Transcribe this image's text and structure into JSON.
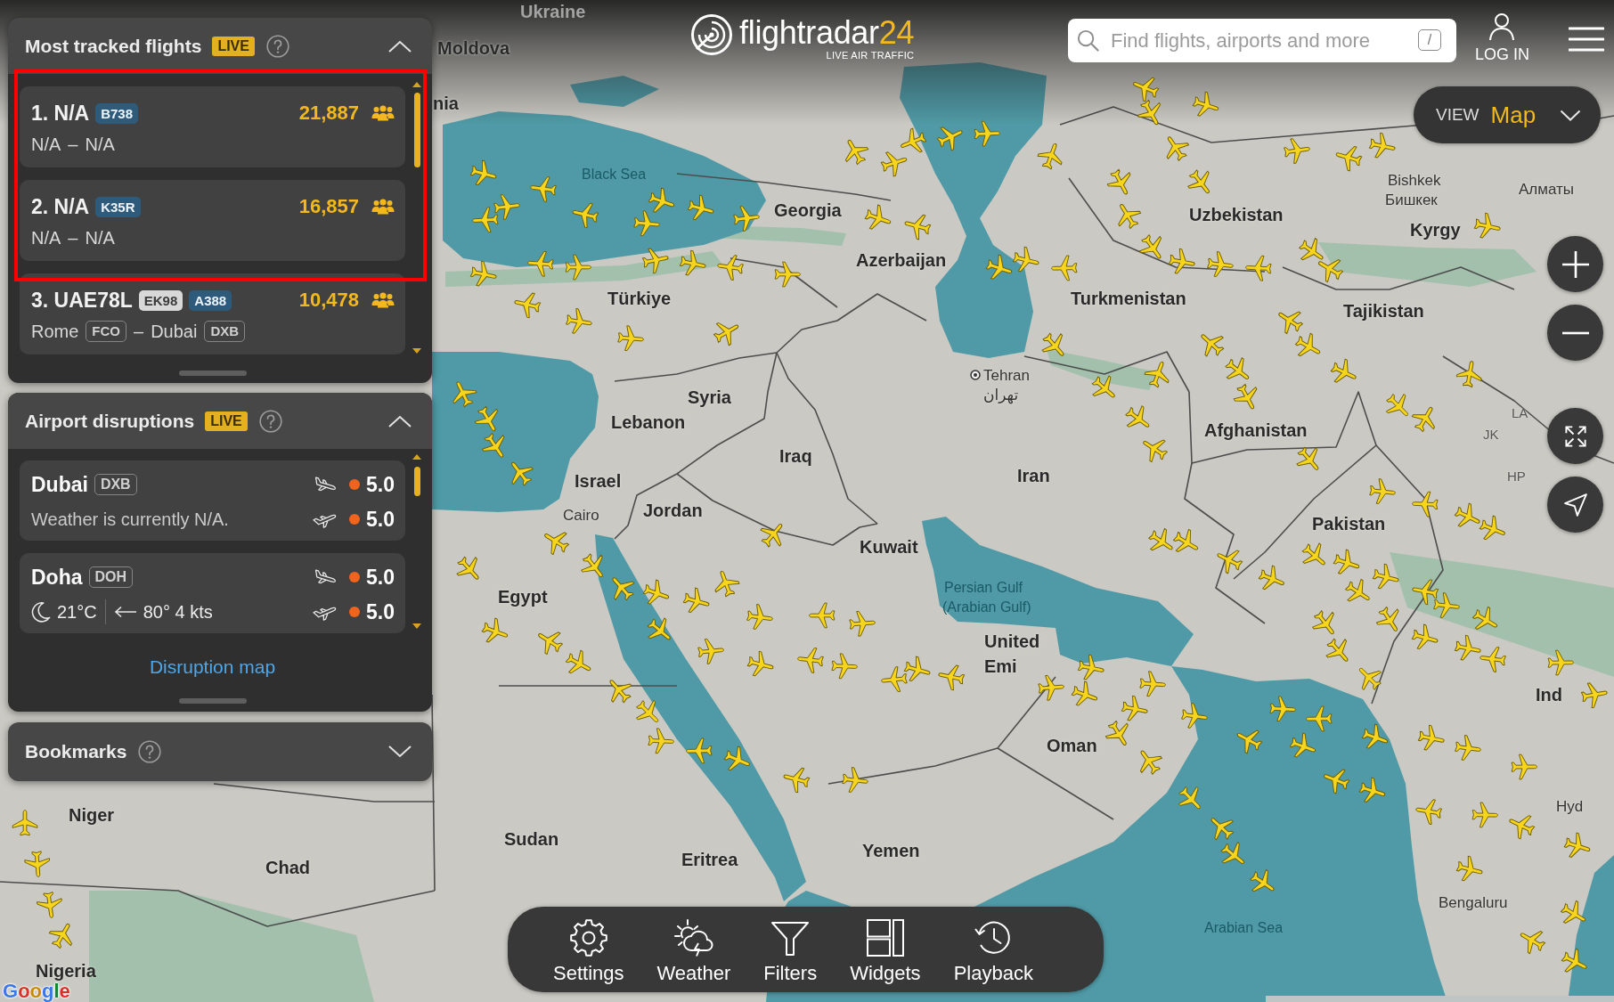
{
  "top_bar": {
    "logo": {
      "name": "flightradar",
      "number": "24",
      "tagline": "LIVE AIR TRAFFIC"
    },
    "search": {
      "placeholder": "Find flights, airports and more",
      "shortcut": "/"
    },
    "login": "LOG IN"
  },
  "view_switch": {
    "label": "VIEW",
    "value": "Map",
    "expanded": false
  },
  "panels": [
    {
      "kind": "flights",
      "title": "Most tracked flights",
      "badge": "LIVE",
      "expanded": true,
      "flights": [
        {
          "title": "1. N/A",
          "aircraft": "B738",
          "trackers": "21,887",
          "origin": "N/A",
          "separator": "–",
          "destination": "N/A",
          "highlighted": true
        },
        {
          "title": "2. N/A",
          "aircraft": "K35R",
          "trackers": "16,857",
          "origin": "N/A",
          "separator": "–",
          "destination": "N/A",
          "highlighted": true
        },
        {
          "title": "3. UAE78L",
          "flight_number": "EK98",
          "aircraft": "A388",
          "trackers": "10,478",
          "origin": "Rome",
          "origin_code": "FCO",
          "separator": "–",
          "destination": "Dubai",
          "destination_code": "DXB",
          "highlighted": false
        }
      ]
    },
    {
      "kind": "disruptions",
      "title": "Airport disruptions",
      "badge": "LIVE",
      "expanded": true,
      "airports": [
        {
          "name": "Dubai",
          "code": "DXB",
          "weather": {
            "kind": "note",
            "text": "Weather is currently N/A."
          },
          "arrivals": {
            "index": "5.0",
            "color": "#f0641e"
          },
          "departures": {
            "index": "5.0",
            "color": "#f0641e"
          }
        },
        {
          "name": "Doha",
          "code": "DOH",
          "weather": {
            "kind": "conditions",
            "temperature": "21°C",
            "wind": "80° 4 kts"
          },
          "arrivals": {
            "index": "5.0",
            "color": "#f0641e"
          },
          "departures": {
            "index": "5.0",
            "color": "#f0641e"
          }
        }
      ],
      "link": "Disruption map"
    },
    {
      "kind": "bookmarks",
      "title": "Bookmarks",
      "expanded": false
    }
  ],
  "map": {
    "labels": [
      {
        "text": "Ukraine",
        "kind": "country"
      },
      {
        "text": "Moldova",
        "kind": "country"
      },
      {
        "text": "nia",
        "kind": "country"
      },
      {
        "text": "Black Sea",
        "kind": "water"
      },
      {
        "text": "Bishkek",
        "kind": "city"
      },
      {
        "text": "Georgia",
        "kind": "country"
      },
      {
        "text": "Uzbekistan",
        "kind": "country"
      },
      {
        "text": "Бишкек",
        "kind": "city"
      },
      {
        "text": "Алматы",
        "kind": "city"
      },
      {
        "text": "Kyrgy",
        "kind": "country"
      },
      {
        "text": "Azerbaijan",
        "kind": "country"
      },
      {
        "text": "Türkiye",
        "kind": "country"
      },
      {
        "text": "Turkmenistan",
        "kind": "country"
      },
      {
        "text": "Tajikistan",
        "kind": "country"
      },
      {
        "text": "Tehran",
        "kind": "capital"
      },
      {
        "text": "Syria",
        "kind": "country"
      },
      {
        "text": "تهران",
        "kind": "city"
      },
      {
        "text": "Lebanon",
        "kind": "country"
      },
      {
        "text": "Afghanistan",
        "kind": "country"
      },
      {
        "text": "LA",
        "kind": "region"
      },
      {
        "text": "JK",
        "kind": "region"
      },
      {
        "text": "Iraq",
        "kind": "country"
      },
      {
        "text": "Israel",
        "kind": "country"
      },
      {
        "text": "Iran",
        "kind": "country"
      },
      {
        "text": "HP",
        "kind": "region"
      },
      {
        "text": "Cairo",
        "kind": "city"
      },
      {
        "text": "Jordan",
        "kind": "country"
      },
      {
        "text": "Pakistan",
        "kind": "country"
      },
      {
        "text": "Kuwait",
        "kind": "country"
      },
      {
        "text": "Egypt",
        "kind": "country"
      },
      {
        "text": "Persian Gulf",
        "kind": "water"
      },
      {
        "text": "(Arabian Gulf)",
        "kind": "water"
      },
      {
        "text": "United",
        "kind": "country"
      },
      {
        "text": "Emi",
        "kind": "country"
      },
      {
        "text": "Ind",
        "kind": "country"
      },
      {
        "text": "Oman",
        "kind": "country"
      },
      {
        "text": "Niger",
        "kind": "country"
      },
      {
        "text": "Hyd",
        "kind": "city"
      },
      {
        "text": "Sudan",
        "kind": "country"
      },
      {
        "text": "Chad",
        "kind": "country"
      },
      {
        "text": "Eritrea",
        "kind": "country"
      },
      {
        "text": "Yemen",
        "kind": "country"
      },
      {
        "text": "Bengaluru",
        "kind": "city"
      },
      {
        "text": "Arabian Sea",
        "kind": "water"
      },
      {
        "text": "Nigeria",
        "kind": "country"
      }
    ],
    "attribution": "Google"
  },
  "toolbar": [
    {
      "kind": "settings",
      "label": "Settings"
    },
    {
      "kind": "weather",
      "label": "Weather"
    },
    {
      "kind": "filters",
      "label": "Filters"
    },
    {
      "kind": "widgets",
      "label": "Widgets"
    },
    {
      "kind": "playback",
      "label": "Playback"
    }
  ]
}
